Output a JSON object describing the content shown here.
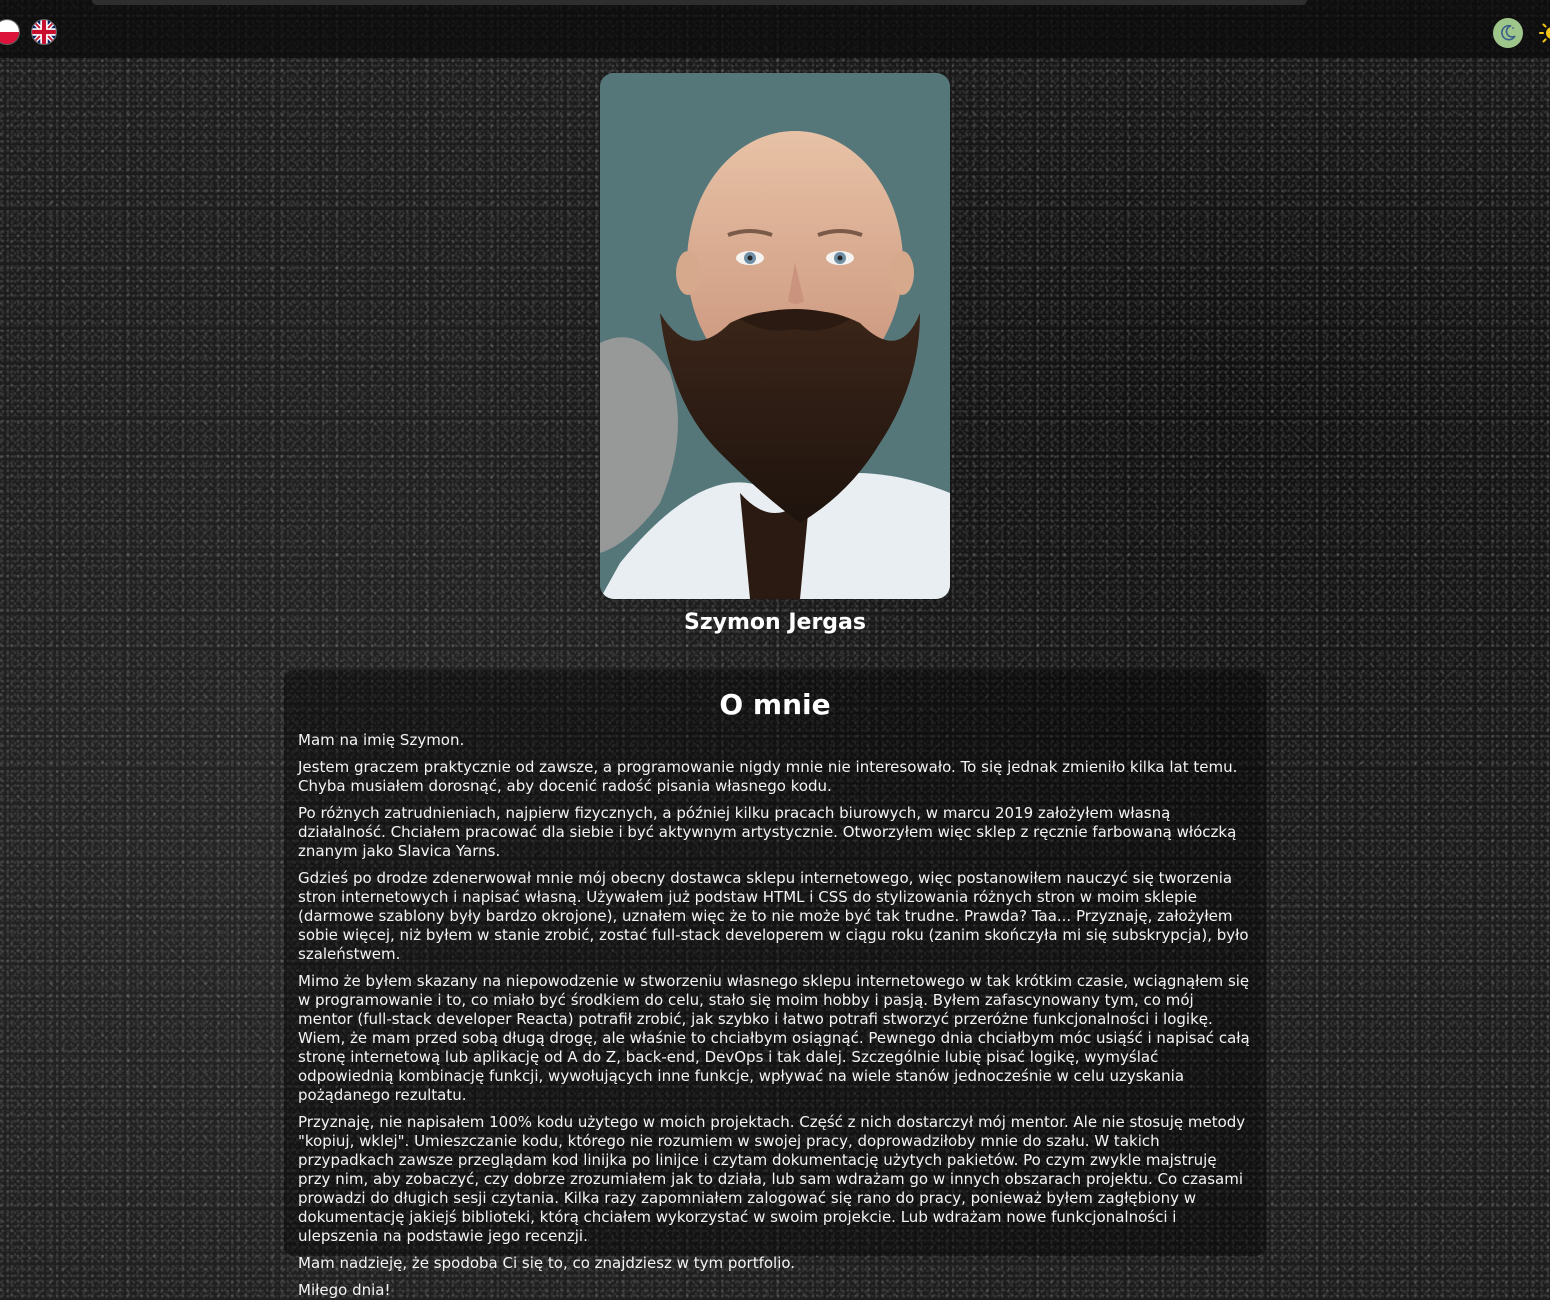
{
  "header": {
    "languages": [
      {
        "code": "pl",
        "icon": "poland-flag-icon"
      },
      {
        "code": "en",
        "icon": "uk-flag-icon"
      }
    ],
    "theme_toggle": [
      {
        "mode": "dark",
        "icon": "moon-icon",
        "color": "#9ec58a"
      },
      {
        "mode": "light",
        "icon": "sun-icon",
        "color": "#f5c518"
      }
    ]
  },
  "profile": {
    "name": "Szymon Jergas"
  },
  "about": {
    "title": "O mnie",
    "paragraphs": [
      "Mam na imię Szymon.",
      "Jestem graczem praktycznie od zawsze, a programowanie nigdy mnie nie interesowało. To się jednak zmieniło kilka lat temu. Chyba musiałem dorosnąć, aby docenić radość pisania własnego kodu.",
      "Po różnych zatrudnieniach, najpierw fizycznych, a później kilku pracach biurowych, w marcu 2019 założyłem własną działalność. Chciałem pracować dla siebie i być aktywnym artystycznie. Otworzyłem więc sklep z ręcznie farbowaną włóczką znanym jako Slavica Yarns.",
      "Gdzieś po drodze zdenerwował mnie mój obecny dostawca sklepu internetowego, więc postanowiłem nauczyć się tworzenia stron internetowych i napisać własną. Używałem już podstaw HTML i CSS do stylizowania różnych stron w moim sklepie (darmowe szablony były bardzo okrojone), uznałem więc że to nie może być tak trudne. Prawda? Taa... Przyznaję, założyłem sobie więcej, niż byłem w stanie zrobić, zostać full-stack developerem w ciągu roku (zanim skończyła mi się subskrypcja), było szaleństwem.",
      "Mimo że byłem skazany na niepowodzenie w stworzeniu własnego sklepu internetowego w tak krótkim czasie, wciągnąłem się w programowanie i to, co miało być środkiem do celu, stało się moim hobby i pasją. Byłem zafascynowany tym, co mój mentor (full-stack developer Reacta) potrafił zrobić, jak szybko i łatwo potrafi stworzyć przeróżne funkcjonalności i logikę. Wiem, że mam przed sobą długą drogę, ale właśnie to chciałbym osiągnąć. Pewnego dnia chciałbym móc usiąść i napisać całą stronę internetową lub aplikację od A do Z, back-end, DevOps i tak dalej. Szczególnie lubię pisać logikę, wymyślać odpowiednią kombinację funkcji, wywołujących inne funkcje, wpływać na wiele stanów jednocześnie w celu uzyskania pożądanego rezultatu.",
      "Przyznaję, nie napisałem 100% kodu użytego w moich projektach. Część z nich dostarczył mój mentor. Ale nie stosuję metody \"kopiuj, wklej\". Umieszczanie kodu, którego nie rozumiem w swojej pracy, doprowadziłoby mnie do szału. W takich przypadkach zawsze przeglądam kod linijka po linijce i czytam dokumentację użytych pakietów. Po czym zwykle majstruję przy nim, aby zobaczyć, czy dobrze zrozumiałem jak to działa, lub sam wdrażam go w innych obszarach projektu. Co czasami prowadzi do długich sesji czytania. Kilka razy zapomniałem zalogować się rano do pracy, ponieważ byłem zagłębiony w dokumentację jakiejś biblioteki, którą chciałem wykorzystać w swoim projekcie. Lub wdrażam nowe funkcjonalności i ulepszenia na podstawie jego recenzji.",
      "Mam nadzieję, że spodoba Ci się to, co znajdziesz w tym portfolio.",
      "Miłego dnia!"
    ]
  }
}
